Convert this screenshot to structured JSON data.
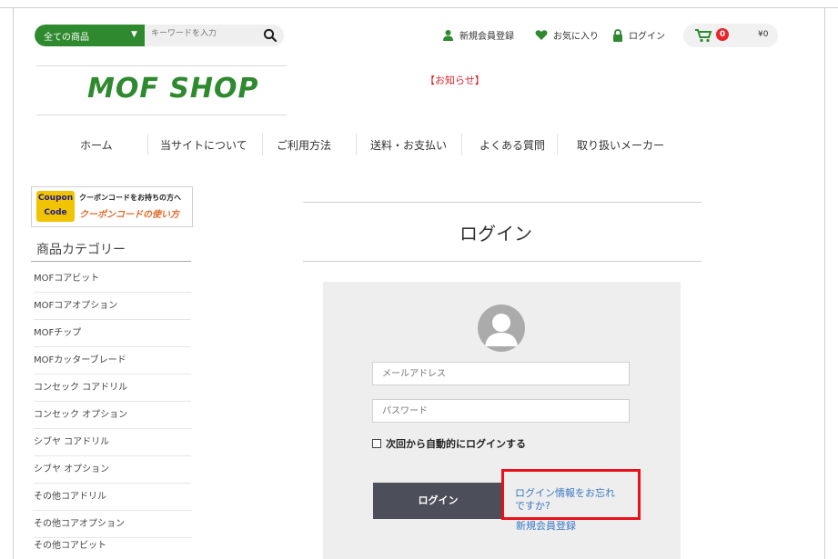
{
  "search": {
    "category_label": "全ての商品",
    "placeholder": "キーワードを入力"
  },
  "header": {
    "register_label": "新規会員登録",
    "favorites_label": "お気に入り",
    "login_label": "ログイン",
    "cart_count": "0",
    "cart_total": "¥0"
  },
  "brand": {
    "logo_text": "MOF SHOP",
    "notice": "【お知らせ】"
  },
  "nav": [
    "ホーム",
    "当サイトについて",
    "ご利用方法",
    "送料・お支払い",
    "よくある質問",
    "取り扱いメーカー"
  ],
  "sidebar": {
    "coupon": {
      "badge_line1": "Coupon",
      "badge_line2": "Code",
      "line1": "クーポンコードをお持ちの方へ",
      "line2": "クーポンコードの使い方"
    },
    "category_title": "商品カテゴリー",
    "categories": [
      "MOFコアビット",
      "MOFコアオプション",
      "MOFチップ",
      "MOFカッターブレード",
      "コンセック コアドリル",
      "コンセック オプション",
      "シブヤ コアドリル",
      "シブヤ オプション",
      "その他コアドリル",
      "その他コアオプション",
      "その他コアビット"
    ]
  },
  "login": {
    "title": "ログイン",
    "email_placeholder": "メールアドレス",
    "password_placeholder": "パスワード",
    "remember_label": "次回から自動的にログインする",
    "submit_label": "ログイン",
    "forgot_line1": "ログイン情報をお忘れ",
    "forgot_line2": "ですか?",
    "register_link": "新規会員登録"
  },
  "colors": {
    "brand_green": "#2f8a2f",
    "notice_red": "#d9232a",
    "link_blue": "#3a78c4",
    "button_dark": "#4c4e5a",
    "highlight_red": "#e8111b"
  }
}
